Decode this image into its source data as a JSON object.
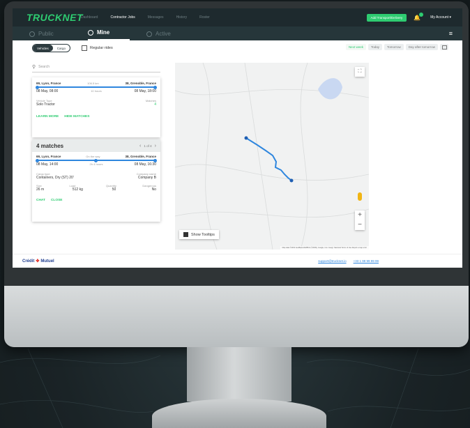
{
  "app": {
    "logo": "TRUCKNET"
  },
  "topnav": {
    "items": [
      "Dashboard",
      "Contractor Jobs",
      "Messages",
      "History",
      "Roster"
    ],
    "active": "Contractor Jobs",
    "add_button": "Add Transport/Delivery",
    "account": "My Account ▾"
  },
  "subnav": {
    "public": "Public",
    "mine": "Mine",
    "active": "Active"
  },
  "toolbar": {
    "vehicles": "Vehicles",
    "cargo": "Cargo",
    "regular_rides": "Regular rides",
    "dates": [
      "Next week",
      "Today",
      "Tomorrow",
      "Day after tomorrow"
    ]
  },
  "search": {
    "placeholder": "Search"
  },
  "card1": {
    "from": "69, Lyon, France",
    "distance": "106.5 km",
    "to": "38, Grenoble, France",
    "start": "08 May, 08:00",
    "duration": "10 hours",
    "end": "08 May, 18:00",
    "vehicle_type_label": "Vehicle Type",
    "vehicle_type": "Solo Tractor",
    "matches_label": "Matches",
    "matches": "4",
    "learn_more": "LEARN MORE",
    "hide_matches": "HIDE MATCHES"
  },
  "card2": {
    "title": "4 matches",
    "pager": "1 of 4",
    "from": "69, Lyon, France",
    "distance": "On the way",
    "to": "38, Grenoble, France",
    "start": "08 May, 14:00",
    "duration": "2h 4 hours",
    "end": "08 May, 16:30",
    "cargo_type_label": "Cargo type",
    "cargo_type": "Containers, Dry (ST) 20'",
    "company_label": "Company name",
    "company": "Company B",
    "size_label": "Size",
    "size": "26 m",
    "load_label": "Load",
    "load": "512 kg",
    "quantity_label": "Quantity",
    "quantity": "50",
    "dangerous_label": "Dangerous",
    "dangerous": "No",
    "chat": "CHAT",
    "close": "CLOSE"
  },
  "map": {
    "show_tooltips": "Show Tooltips",
    "attribution": "Map data ©2019 GeoBasis-DE/BKG (©2009), Google, Inst. Geogr. Nacional   Terms of Use   Report a map error"
  },
  "footer": {
    "sponsor_a": "Crédit",
    "sponsor_b": "Mutuel",
    "email": "support@trucknet.io",
    "phone": "+33 1 99 99 99 99"
  },
  "colors": {
    "brand": "#2ecc71",
    "route": "#2e86de",
    "nav": "#1e2a2e"
  }
}
